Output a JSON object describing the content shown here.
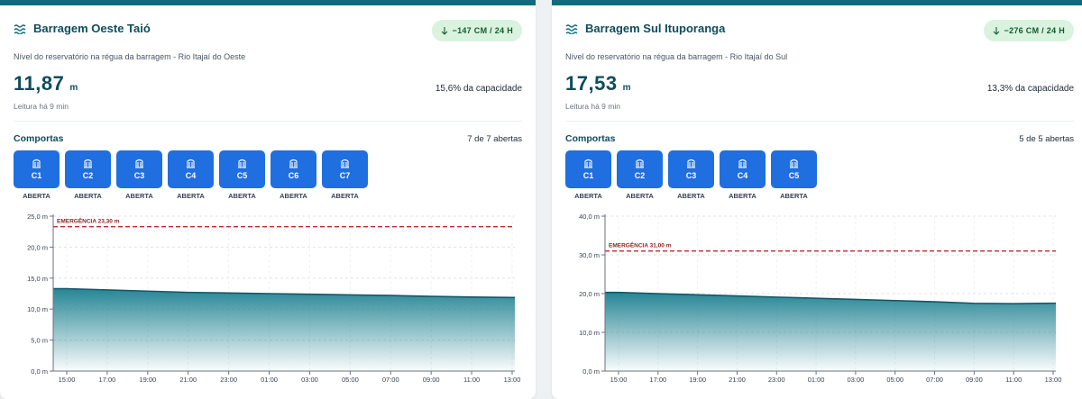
{
  "cards": [
    {
      "title": "Barragem Oeste Taió",
      "trend_badge": "−147 CM / 24 H",
      "subtitle": "Nível do reservatório na régua da barragem - Rio Itajaí do Oeste",
      "level_value": "11,87",
      "level_unit": "m",
      "capacity": "15,6% da capacidade",
      "reading": "Leitura há 9 min",
      "gates_title": "Comportas",
      "gates_count": "7 de 7 abertas",
      "gates": [
        {
          "code": "C1",
          "status": "ABERTA"
        },
        {
          "code": "C2",
          "status": "ABERTA"
        },
        {
          "code": "C3",
          "status": "ABERTA"
        },
        {
          "code": "C4",
          "status": "ABERTA"
        },
        {
          "code": "C5",
          "status": "ABERTA"
        },
        {
          "code": "C6",
          "status": "ABERTA"
        },
        {
          "code": "C7",
          "status": "ABERTA"
        }
      ],
      "chart_data": {
        "type": "area",
        "x": [
          "15:00",
          "17:00",
          "19:00",
          "21:00",
          "23:00",
          "01:00",
          "03:00",
          "05:00",
          "07:00",
          "09:00",
          "11:00",
          "13:00"
        ],
        "ylim": [
          0,
          25
        ],
        "yticks": [
          "0,0 m",
          "5,0 m",
          "10,0 m",
          "15,0 m",
          "20,0 m",
          "25,0 m"
        ],
        "values": [
          13.3,
          13.1,
          12.9,
          12.7,
          12.6,
          12.5,
          12.4,
          12.3,
          12.2,
          12.05,
          11.95,
          11.87
        ],
        "threshold": {
          "label": "EMERGÊNCIA 23,30 m",
          "value": 23.3
        },
        "grid": true
      }
    },
    {
      "title": "Barragem Sul Ituporanga",
      "trend_badge": "−276 CM / 24 H",
      "subtitle": "Nível do reservatório na régua da barragem - Rio Itajaí do Sul",
      "level_value": "17,53",
      "level_unit": "m",
      "capacity": "13,3% da capacidade",
      "reading": "Leitura há 9 min",
      "gates_title": "Comportas",
      "gates_count": "5 de 5 abertas",
      "gates": [
        {
          "code": "C1",
          "status": "ABERTA"
        },
        {
          "code": "C2",
          "status": "ABERTA"
        },
        {
          "code": "C3",
          "status": "ABERTA"
        },
        {
          "code": "C4",
          "status": "ABERTA"
        },
        {
          "code": "C5",
          "status": "ABERTA"
        }
      ],
      "chart_data": {
        "type": "area",
        "x": [
          "15:00",
          "17:00",
          "19:00",
          "21:00",
          "23:00",
          "01:00",
          "03:00",
          "05:00",
          "07:00",
          "09:00",
          "11:00",
          "13:00"
        ],
        "ylim": [
          0,
          40
        ],
        "yticks": [
          "0,0 m",
          "10,0 m",
          "20,0 m",
          "30,0 m",
          "40,0 m"
        ],
        "values": [
          20.3,
          20.0,
          19.7,
          19.4,
          19.1,
          18.8,
          18.5,
          18.2,
          17.9,
          17.5,
          17.4,
          17.53
        ],
        "threshold": {
          "label": "EMERGÊNCIA 31,00 m",
          "value": 31.0
        },
        "grid": true
      }
    }
  ],
  "colors": {
    "accent": "#0f6b7d",
    "gate_blue": "#1f6fe0",
    "emergency": "#c0292b",
    "badge_bg": "#d9f3df"
  },
  "icons": {
    "title": "water-waves-icon",
    "badge": "arrow-down-icon",
    "gate": "floodgate-icon"
  }
}
